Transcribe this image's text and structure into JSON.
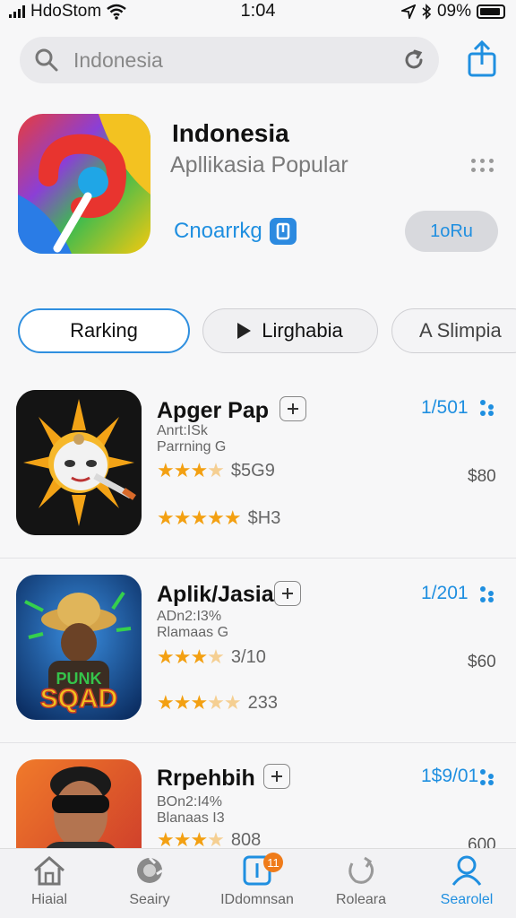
{
  "status_bar": {
    "carrier": "HdoStom",
    "time": "1:04",
    "battery": "09%"
  },
  "search": {
    "value": "Indonesia"
  },
  "header": {
    "title": "Indonesia",
    "subtitle": "Apllikasia Popular",
    "ranking_link": "Cnoarrkg",
    "get_button": "1oRu"
  },
  "tabs": [
    {
      "label": "Rarking"
    },
    {
      "label": "Lirghabia"
    },
    {
      "label": "A Slimpia"
    }
  ],
  "apps": [
    {
      "name": "Apger Pap",
      "meta1": "Anrt:ISk",
      "meta2": "Parrning G",
      "rating1_count": "$5G9",
      "rating2_count": "$H3",
      "rank": "1/501",
      "price": "$80",
      "rating1": 3.5,
      "rating2": 5
    },
    {
      "name": "Aplik/Jasia",
      "meta1": "ADn2:I3%",
      "meta2": "Rlamaas G",
      "rating1_count": "3/10",
      "rating2_count": "233",
      "rank": "1/201",
      "price": "$60",
      "rating1": 3.5,
      "rating2": 3
    },
    {
      "name": "Rrpehbih",
      "meta1": "BOn2:I4%",
      "meta2": "Blanaas I3",
      "rating1_count": "808",
      "rating2_count": "",
      "rank": "1$9/01",
      "price": "600",
      "rating1": 3.5,
      "rating2": 0
    }
  ],
  "bottom_nav": [
    {
      "label": "Hiaial",
      "icon": "home-icon"
    },
    {
      "label": "Seairy",
      "icon": "game-icon"
    },
    {
      "label": "IDdomnsan",
      "icon": "apps-icon",
      "badge": "11"
    },
    {
      "label": "Roleara",
      "icon": "update-icon"
    },
    {
      "label": "Searolel",
      "icon": "person-icon",
      "active": true
    }
  ],
  "colors": {
    "accent": "#1f8fe0",
    "star": "#f3a012",
    "badge": "#ef7b1a"
  }
}
